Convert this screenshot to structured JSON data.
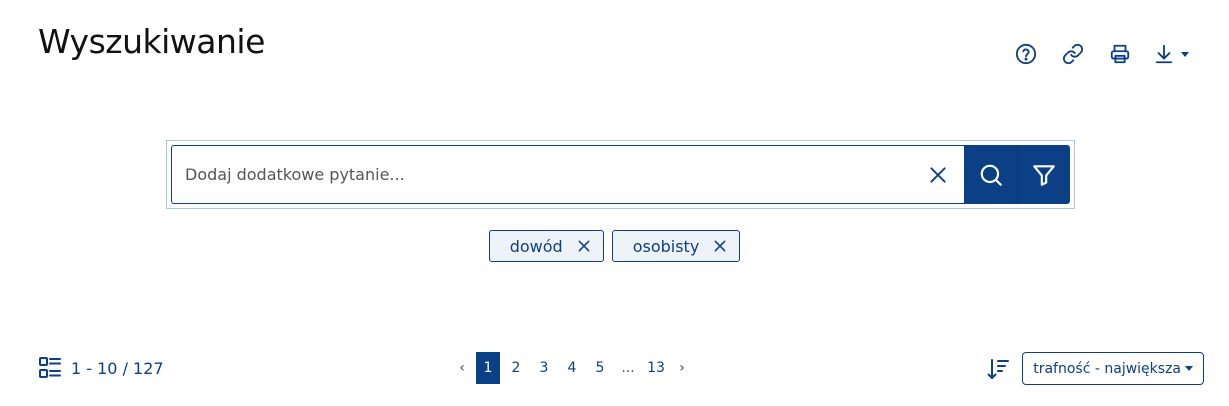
{
  "header": {
    "title": "Wyszukiwanie"
  },
  "toolbar": {
    "icons": [
      "help-circle-icon",
      "link-icon",
      "printer-icon",
      "download-icon"
    ]
  },
  "search": {
    "placeholder": "Dodaj dodatkowe pytanie...",
    "value": ""
  },
  "chips": [
    {
      "label": "dowód"
    },
    {
      "label": "osobisty"
    }
  ],
  "results": {
    "count_text": "1 - 10 / 127"
  },
  "pagination": {
    "prev": "‹",
    "next": "›",
    "pages": [
      "1",
      "2",
      "3",
      "4",
      "5"
    ],
    "ellipsis": "...",
    "last": "13",
    "current": "1"
  },
  "sort": {
    "selected": "trafność - największa"
  },
  "colors": {
    "primary": "#0b3f86",
    "chip_bg": "#eef3fa",
    "outline": "#a9c5e6"
  }
}
